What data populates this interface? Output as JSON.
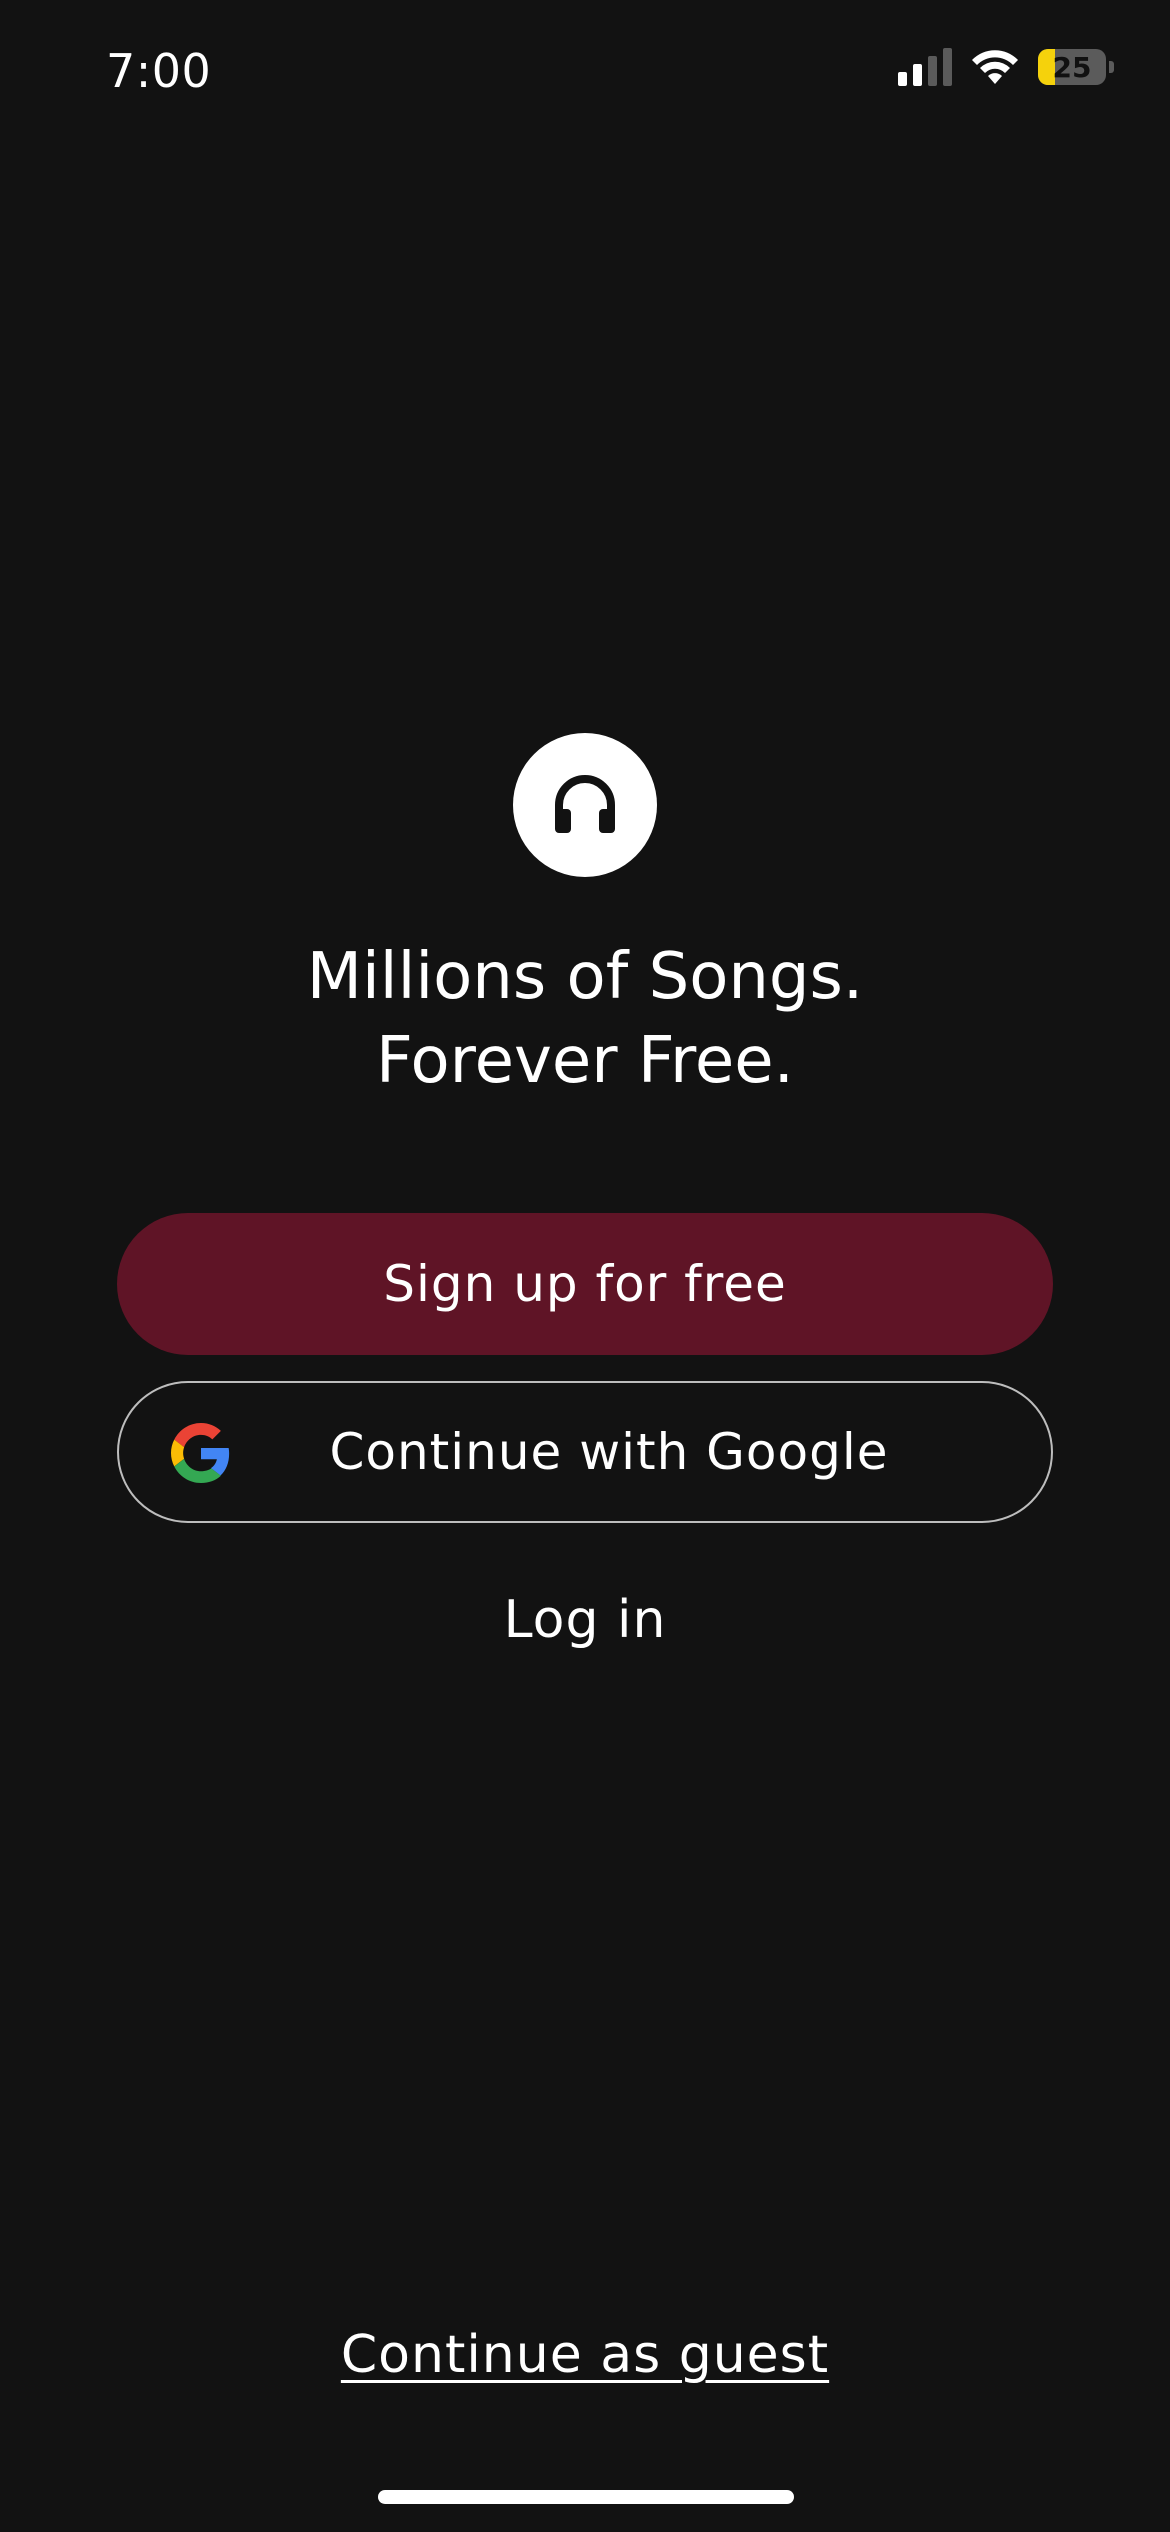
{
  "status_bar": {
    "time": "7:00",
    "battery_level": "25",
    "battery_fraction": 0.25,
    "battery_color": "#f5d20c",
    "icons": [
      "signal-icon",
      "wifi-icon",
      "battery-icon"
    ]
  },
  "logo": {
    "icon": "headphones-icon"
  },
  "headline": {
    "line1": "Millions of Songs.",
    "line2": "Forever Free."
  },
  "actions": {
    "signup_label": "Sign up for free",
    "google_label": "Continue with Google",
    "login_label": "Log in",
    "guest_label": "Continue as guest"
  },
  "colors": {
    "background": "#121212",
    "signup_button": "#5f1426",
    "google_border": "#bdbdbd"
  }
}
